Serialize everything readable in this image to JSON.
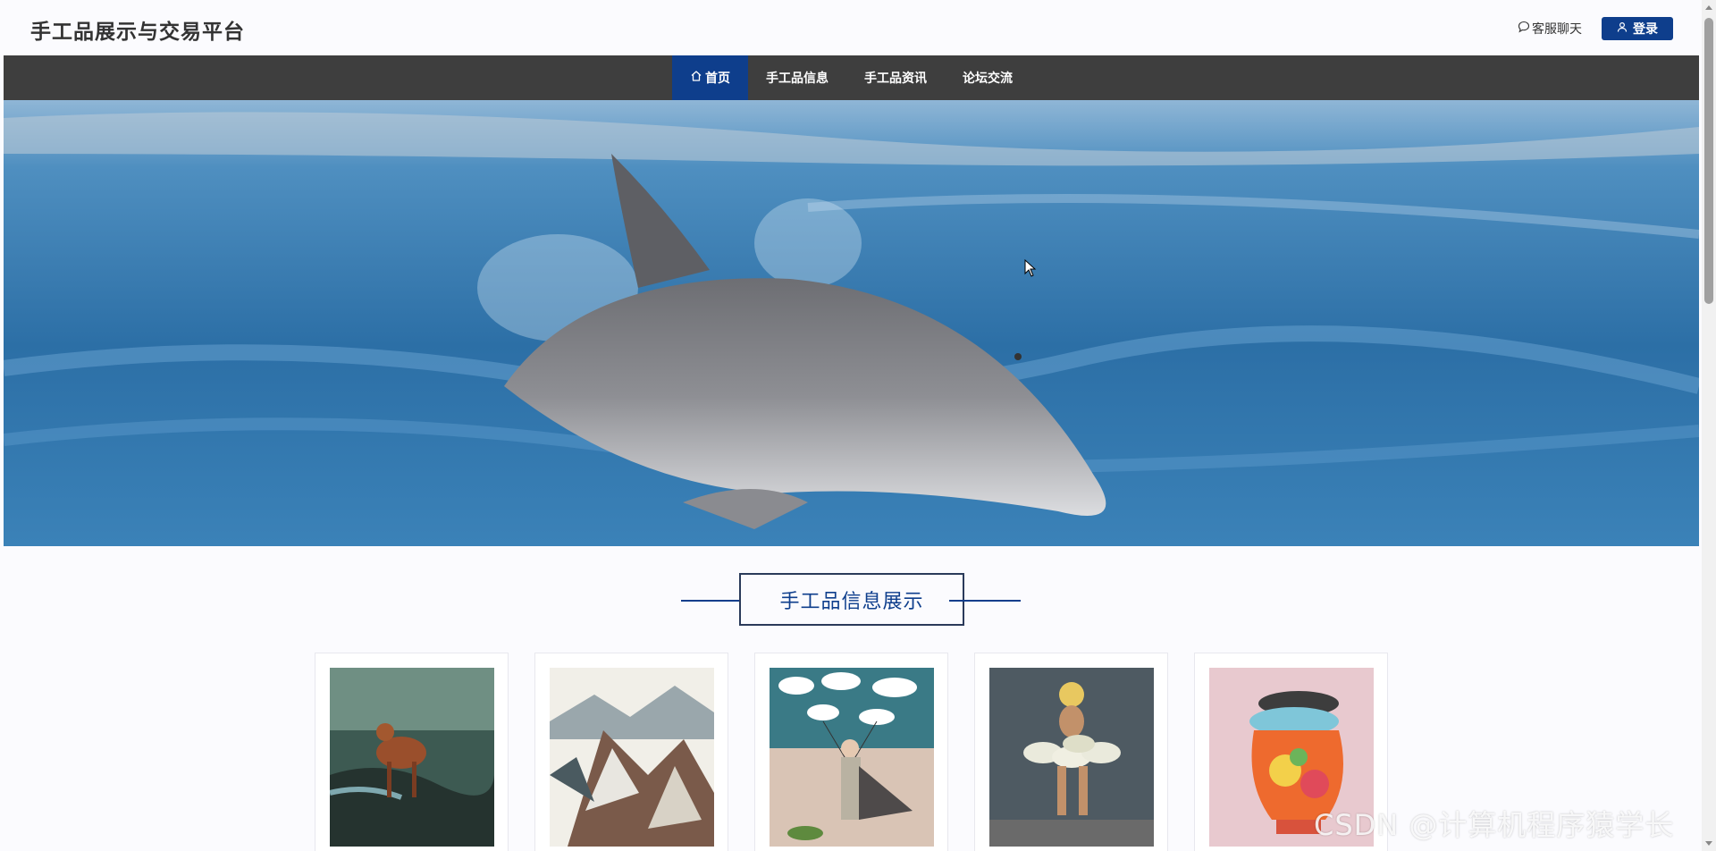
{
  "header": {
    "site_title": "手工品展示与交易平台",
    "chat_label": "客服聊天",
    "login_label": "登录"
  },
  "nav": {
    "items": [
      {
        "label": "首页",
        "active": true
      },
      {
        "label": "手工品信息",
        "active": false
      },
      {
        "label": "手工品资讯",
        "active": false
      },
      {
        "label": "论坛交流",
        "active": false
      }
    ]
  },
  "banner": {
    "subject": "dolphin-swimming-in-ocean"
  },
  "section": {
    "title": "手工品信息展示"
  },
  "products": [
    {
      "image": "painting-bull-landscape"
    },
    {
      "image": "painting-snowy-mountains"
    },
    {
      "image": "painting-woman-with-clouds"
    },
    {
      "image": "painting-figure-pebble-art"
    },
    {
      "image": "painting-bird-vase-flowers"
    }
  ],
  "watermark": "CSDN @计算机程序猿学长",
  "colors": {
    "primary": "#0e3e8c",
    "nav_bg": "#3e3e3e",
    "page_bg": "#fbfbfe"
  }
}
